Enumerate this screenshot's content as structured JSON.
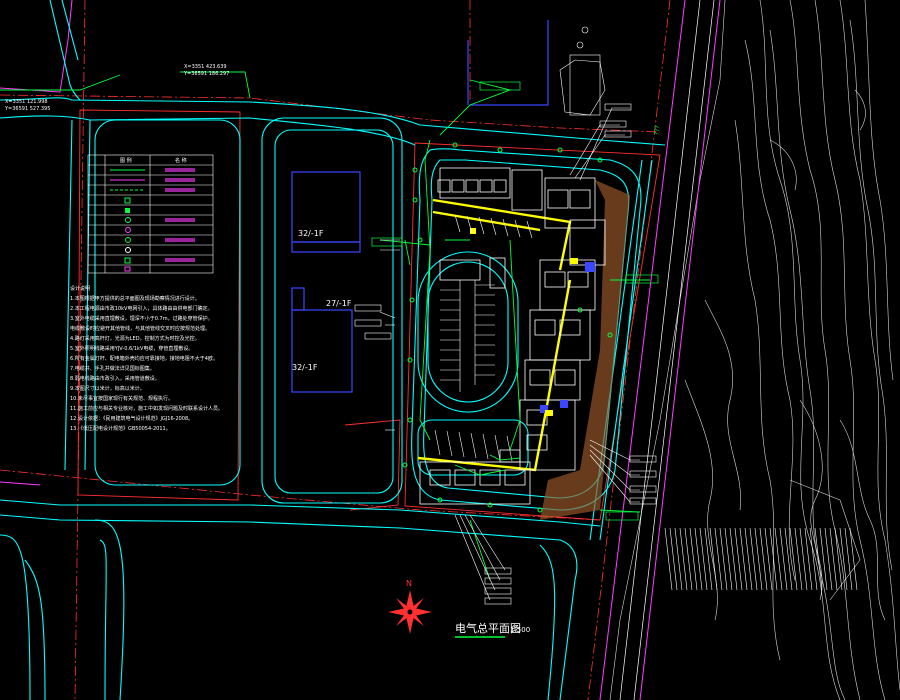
{
  "drawing": {
    "title": "电气总平面图",
    "scale": "1:500",
    "north_label": "N",
    "coords": {
      "left_x": "X=3351 121.998",
      "left_y": "Y=36591 527.395",
      "top_x": "X=3351 423.639",
      "top_y": "Y=36591 186.297"
    },
    "buildings": [
      "32/-1F",
      "27/-1F",
      "32/-1F"
    ],
    "road_label": "???",
    "colors": {
      "background": "#000000",
      "road": "#00ffff",
      "boundary": "#ff3030",
      "building": "#3b47ff",
      "annotation": "#00ff3c",
      "highlight": "#ffff00",
      "property_line": "#ff3cff",
      "terrain": "#ffffff",
      "slope": "#a05a2c"
    }
  },
  "legend": {
    "header_col1": "图 例",
    "header_col2": "名 称",
    "rows": [
      "",
      "",
      "",
      "",
      "",
      "",
      "",
      "",
      "",
      "",
      ""
    ]
  },
  "notes": {
    "title": "设计说明",
    "lines": [
      "1.本图根据甲方提供的总平面图及现场勘察情况进行设计。",
      "2.本工程电源由市政10kV电网引入，具体路由由供电部门确定。",
      "3.室外电缆采用直埋敷设，埋深不小于0.7m，过路处穿管保护。",
      "  电缆敷设时应避开其他管线，与其他管线交叉时应按规范处理。",
      "4.路灯采用高杆灯，光源为LED，控制方式为时控及光控。",
      "5.室外照明线路采用YJV-0.6/1kV电缆，穿管直埋敷设。",
      "6.所有金属灯杆、配电箱外壳均应可靠接地，接地电阻不大于4欧。",
      "7.电缆井、手孔井做法详见国标图集。",
      "8.弱电线路由市政引入，采用管道敷设。",
      "9.本图尺寸以米计，标高以米计。",
      "10.未尽事宜按国家现行有关规范、规程执行。",
      "11.施工前应与相关专业核对，施工中如发现问题及时联系设计人员。",
      "12.设计依据：《民用建筑电气设计规范》JGJ16-2008。",
      "13.《低压配电设计规范》GB50054-2011。"
    ]
  }
}
